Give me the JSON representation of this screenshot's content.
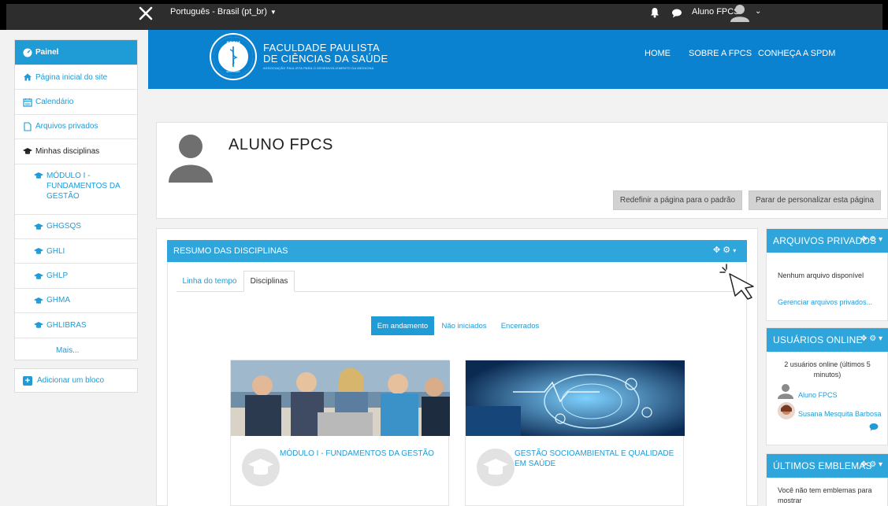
{
  "topbar": {
    "language": "Português - Brasil (pt_br)",
    "user_name": "Aluno FPCS"
  },
  "sidebar": {
    "items": [
      {
        "label": "Painel"
      },
      {
        "label": "Página inicial do site"
      },
      {
        "label": "Calendário"
      },
      {
        "label": "Arquivos privados"
      },
      {
        "label": "Minhas disciplinas"
      },
      {
        "label": "MÓDULO I - FUNDAMENTOS DA GESTÃO"
      },
      {
        "label": "GHGSQS"
      },
      {
        "label": "GHLI"
      },
      {
        "label": "GHLP"
      },
      {
        "label": "GHMA"
      },
      {
        "label": "GHLIBRAS"
      },
      {
        "label": "Mais..."
      }
    ],
    "add_block": "Adicionar um bloco"
  },
  "header": {
    "logo_badge_top": "SPDM",
    "logo_badge_bottom": "EDUCAÇÃO",
    "title_line1": "FACULDADE PAULISTA",
    "title_line2": "DE CIÊNCIAS DA SAÚDE",
    "subtitle": "ASSOCIAÇÃO PAULISTA PARA O DESENVOLVIMENTO DA MEDICINA",
    "nav": [
      {
        "label": "HOME"
      },
      {
        "label": "SOBRE A FPCS"
      },
      {
        "label": "CONHEÇA A SPDM"
      }
    ]
  },
  "profile": {
    "name": "ALUNO FPCS",
    "reset_button": "Redefinir a página para o padrão",
    "stop_button": "Parar de personalizar esta página"
  },
  "overview": {
    "title": "RESUMO DAS DISCIPLINAS",
    "tabs": [
      {
        "label": "Linha do tempo"
      },
      {
        "label": "Disciplinas"
      }
    ],
    "filters": [
      {
        "label": "Em andamento"
      },
      {
        "label": "Não iniciados"
      },
      {
        "label": "Encerrados"
      }
    ],
    "courses": [
      {
        "title": "MÓDULO I - FUNDAMENTOS DA GESTÃO"
      },
      {
        "title": "GESTÃO SOCIOAMBIENTAL E QUALIDADE EM SAÚDE"
      }
    ]
  },
  "blocks": {
    "private_files": {
      "title": "ARQUIVOS PRIVADOS",
      "empty": "Nenhum arquivo disponível",
      "manage_link": "Gerenciar arquivos privados..."
    },
    "online_users": {
      "title": "USUÁRIOS ONLINE",
      "summary": "2 usuários online (últimos 5 minutos)",
      "users": [
        {
          "name": "Aluno FPCS"
        },
        {
          "name": "Susana Mesquita Barbosa"
        }
      ]
    },
    "badges": {
      "title": "ÚLTIMOS EMBLEMAS",
      "empty": "Você não tem emblemas para mostrar"
    }
  },
  "colors": {
    "accent": "#1f9bd6",
    "block_header": "#2fa6db",
    "banner": "#0a82d0",
    "topbar": "#2d2d2d"
  }
}
